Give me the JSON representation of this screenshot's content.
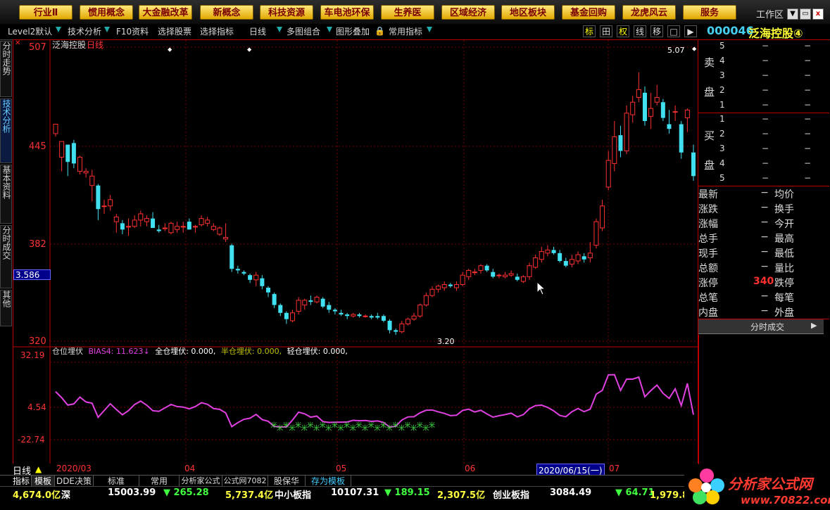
{
  "menu": [
    "行业Ⅱ",
    "惯用概念",
    "大金融改革",
    "新概念",
    "科技资源",
    "车电池环保",
    "生养医",
    "区域经济",
    "地区板块",
    "基金回购",
    "龙虎风云",
    "服务"
  ],
  "workzone": {
    "label": "工作区",
    "close": "x"
  },
  "toolbar": {
    "level2": "Level2默认",
    "tech": "技术分析",
    "f10": "F10资料",
    "select_stock": "选择股票",
    "select_ind": "选择指标",
    "period": "日线",
    "multi": "多图组合",
    "overlay": "图形叠加",
    "common_ind": "常用指标",
    "icons": [
      "标",
      "田",
      "权",
      "线",
      "移",
      "□",
      "▶"
    ]
  },
  "stock": {
    "code": "000046",
    "name": "泛海控股④"
  },
  "left_tabs": [
    "分时走势",
    "技术分析",
    "基本资料",
    "分时成交",
    "其他"
  ],
  "chart": {
    "title": "泛海控股",
    "period": "日线",
    "y_labels": [
      "507",
      "445",
      "382",
      "320"
    ],
    "current_price": "3.586",
    "high_mark": "5.07",
    "low_mark": "3.20",
    "indicator_title": "仓位埋伏",
    "indicator_values": [
      {
        "label": "BIAS4: ",
        "value": "11.623↓",
        "color": "#e040e0"
      },
      {
        "label": "全仓埋伏: ",
        "value": "0.000,",
        "color": "#ffffff"
      },
      {
        "label": "半仓埋伏: ",
        "value": "0.000,",
        "color": "#c0c000"
      },
      {
        "label": "轻仓埋伏: ",
        "value": "0.000,",
        "color": "#ffffff"
      }
    ],
    "ind_y_labels": [
      "32.19",
      "4.54",
      "-22.74"
    ],
    "x_labels": [
      "2020/03",
      "04",
      "05",
      "06",
      "07"
    ],
    "cursor_date": "2020/06/15(一)",
    "period_label": "日线"
  },
  "orderbook": {
    "sell_label": [
      "卖",
      "盘"
    ],
    "buy_label": [
      "买",
      "盘"
    ],
    "sell_levels": [
      "5",
      "4",
      "3",
      "2",
      "1"
    ],
    "buy_levels": [
      "1",
      "2",
      "3",
      "4",
      "5"
    ],
    "dash": "−"
  },
  "quote": [
    {
      "l": "最新",
      "m": "−",
      "r": "均价"
    },
    {
      "l": "涨跌",
      "m": "−",
      "r": "换手"
    },
    {
      "l": "涨幅",
      "m": "−",
      "r": "今开"
    },
    {
      "l": "总手",
      "m": "−",
      "r": "最高"
    },
    {
      "l": "现手",
      "m": "−",
      "r": "最低"
    },
    {
      "l": "总额",
      "m": "−",
      "r": "量比"
    },
    {
      "l": "涨停",
      "m": "340",
      "r": "跌停"
    },
    {
      "l": "总笔",
      "m": "−",
      "r": "每笔"
    },
    {
      "l": "内盘",
      "m": "−",
      "r": "外盘"
    }
  ],
  "timeshare_btn": "分时成交",
  "bottom_tabs": [
    "指标",
    "模板",
    "DDE决策",
    "标准",
    "常用",
    "分析家公式",
    "公式网7082",
    "股保华",
    "存为模板"
  ],
  "ticker": [
    {
      "t": "4,674.0亿",
      "c": "#ffff40"
    },
    {
      "t": "深",
      "c": "#ffffff"
    },
    {
      "t": "15003.99",
      "c": "#ffffff"
    },
    {
      "t": "▼ 265.28",
      "c": "#40ff40"
    },
    {
      "t": "5,737.4亿",
      "c": "#ffff40"
    },
    {
      "t": "中小板指",
      "c": "#ffffff"
    },
    {
      "t": "10107.31",
      "c": "#ffffff"
    },
    {
      "t": "▼ 189.15",
      "c": "#40ff40"
    },
    {
      "t": "2,307.5亿",
      "c": "#ffff40"
    },
    {
      "t": "创业板指",
      "c": "#ffffff"
    },
    {
      "t": "3084.49",
      "c": "#ffffff"
    },
    {
      "t": "▼ 64.71",
      "c": "#40ff40"
    },
    {
      "t": "1,979.8亿",
      "c": "#ffff40"
    }
  ],
  "logo": {
    "text": "分析家公式网",
    "url": "www.70822.com"
  },
  "chart_data": {
    "type": "candlestick",
    "candles": [
      [
        452,
        458,
        450,
        457
      ],
      [
        437,
        447,
        428,
        442
      ],
      [
        445,
        434,
        425,
        440
      ],
      [
        446,
        433,
        430,
        448
      ],
      [
        428,
        437,
        426,
        438
      ],
      [
        427,
        428,
        424,
        430
      ],
      [
        419,
        425,
        409,
        429
      ],
      [
        419,
        404,
        397,
        420
      ],
      [
        406,
        406,
        401,
        410
      ],
      [
        406,
        410,
        403,
        413
      ],
      [
        396,
        399,
        389,
        401
      ],
      [
        395,
        391,
        388,
        397
      ],
      [
        393,
        393,
        387,
        398
      ],
      [
        393,
        397,
        392,
        400
      ],
      [
        397,
        401,
        393,
        403
      ],
      [
        396,
        398,
        393,
        400
      ],
      [
        398,
        392,
        392,
        402
      ],
      [
        391,
        390,
        389,
        394
      ],
      [
        392,
        392,
        390,
        395
      ],
      [
        389,
        395,
        388,
        396
      ],
      [
        391,
        393,
        389,
        396
      ],
      [
        393,
        393,
        389,
        396
      ],
      [
        396,
        391,
        391,
        398
      ],
      [
        393,
        393,
        389,
        394
      ],
      [
        394,
        398,
        393,
        400
      ],
      [
        395,
        397,
        393,
        399
      ],
      [
        391,
        393,
        390,
        395
      ],
      [
        388,
        392,
        387,
        393
      ],
      [
        385,
        386,
        383,
        395
      ],
      [
        381,
        366,
        364,
        382
      ],
      [
        366,
        365,
        363,
        368
      ],
      [
        364,
        363,
        362,
        365
      ],
      [
        362,
        359,
        357,
        363
      ],
      [
        359,
        362,
        355,
        364
      ],
      [
        360,
        355,
        353,
        362
      ],
      [
        354,
        351,
        348,
        355
      ],
      [
        350,
        343,
        341,
        351
      ],
      [
        343,
        338,
        336,
        344
      ],
      [
        338,
        334,
        331,
        339
      ],
      [
        333,
        338,
        332,
        340
      ],
      [
        339,
        346,
        337,
        348
      ],
      [
        343,
        346,
        340,
        347
      ],
      [
        346,
        345,
        343,
        349
      ],
      [
        345,
        348,
        344,
        349
      ],
      [
        347,
        342,
        341,
        348
      ],
      [
        343,
        340,
        338,
        345
      ],
      [
        340,
        339,
        337,
        341
      ],
      [
        338,
        337,
        336,
        340
      ],
      [
        337,
        336,
        334,
        338
      ],
      [
        336,
        337,
        335,
        338
      ],
      [
        337,
        336,
        335,
        338
      ],
      [
        336,
        336,
        335,
        337
      ],
      [
        336,
        335,
        334,
        337
      ],
      [
        336,
        335,
        334,
        338
      ],
      [
        336,
        333,
        332,
        337
      ],
      [
        333,
        327,
        325,
        334
      ],
      [
        327,
        326,
        324,
        328
      ],
      [
        326,
        331,
        325,
        333
      ],
      [
        331,
        334,
        330,
        335
      ],
      [
        334,
        336,
        333,
        338
      ],
      [
        336,
        343,
        335,
        344
      ],
      [
        343,
        349,
        342,
        351
      ],
      [
        349,
        353,
        348,
        355
      ],
      [
        353,
        355,
        351,
        356
      ],
      [
        354,
        356,
        352,
        358
      ],
      [
        356,
        355,
        354,
        357
      ],
      [
        354,
        356,
        352,
        358
      ],
      [
        356,
        362,
        355,
        364
      ],
      [
        361,
        365,
        359,
        366
      ],
      [
        364,
        364,
        362,
        366
      ],
      [
        365,
        368,
        363,
        369
      ],
      [
        368,
        365,
        364,
        369
      ],
      [
        364,
        361,
        360,
        366
      ],
      [
        362,
        362,
        360,
        363
      ],
      [
        361,
        362,
        360,
        364
      ],
      [
        362,
        363,
        361,
        365
      ],
      [
        361,
        359,
        358,
        363
      ],
      [
        358,
        361,
        357,
        362
      ],
      [
        361,
        368,
        359,
        370
      ],
      [
        367,
        373,
        366,
        375
      ],
      [
        372,
        377,
        370,
        380
      ],
      [
        376,
        378,
        374,
        381
      ],
      [
        378,
        376,
        375,
        380
      ],
      [
        376,
        371,
        370,
        378
      ],
      [
        371,
        368,
        367,
        373
      ],
      [
        369,
        372,
        367,
        375
      ],
      [
        371,
        375,
        369,
        377
      ],
      [
        374,
        372,
        370,
        376
      ],
      [
        373,
        376,
        370,
        383
      ],
      [
        381,
        396,
        379,
        398
      ],
      [
        392,
        406,
        390,
        410
      ],
      [
        418,
        435,
        416,
        441
      ],
      [
        433,
        450,
        428,
        460
      ],
      [
        451,
        441,
        437,
        457
      ],
      [
        441,
        465,
        439,
        470
      ],
      [
        464,
        472,
        459,
        476
      ],
      [
        475,
        480,
        472,
        491
      ],
      [
        478,
        460,
        457,
        482
      ],
      [
        463,
        468,
        455,
        478
      ],
      [
        472,
        475,
        470,
        483
      ],
      [
        472,
        462,
        460,
        474
      ],
      [
        458,
        455,
        452,
        467
      ],
      [
        466,
        466,
        460,
        470
      ],
      [
        458,
        440,
        436,
        460
      ],
      [
        462,
        467,
        453,
        468
      ],
      [
        440,
        425,
        422,
        445
      ]
    ]
  }
}
